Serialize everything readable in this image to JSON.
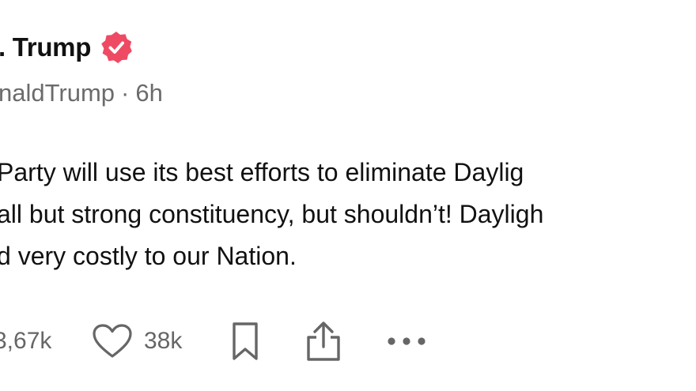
{
  "author": {
    "display_name": ". Trump",
    "handle": "naldTrump",
    "timestamp": "6h",
    "separator": "·",
    "verified_icon": "verified-badge-icon",
    "verified_color": "#ef4a63"
  },
  "post": {
    "lines": [
      "Party will use its best efforts to eliminate Daylig",
      "all but strong constituency, but shouldn’t! Dayligh",
      "d very costly to our Nation."
    ]
  },
  "actions": {
    "repost_count": "3,67k",
    "like_count": "38k",
    "like_icon": "heart-icon",
    "bookmark_icon": "bookmark-icon",
    "share_icon": "share-icon",
    "more_icon": "more-options-icon"
  }
}
